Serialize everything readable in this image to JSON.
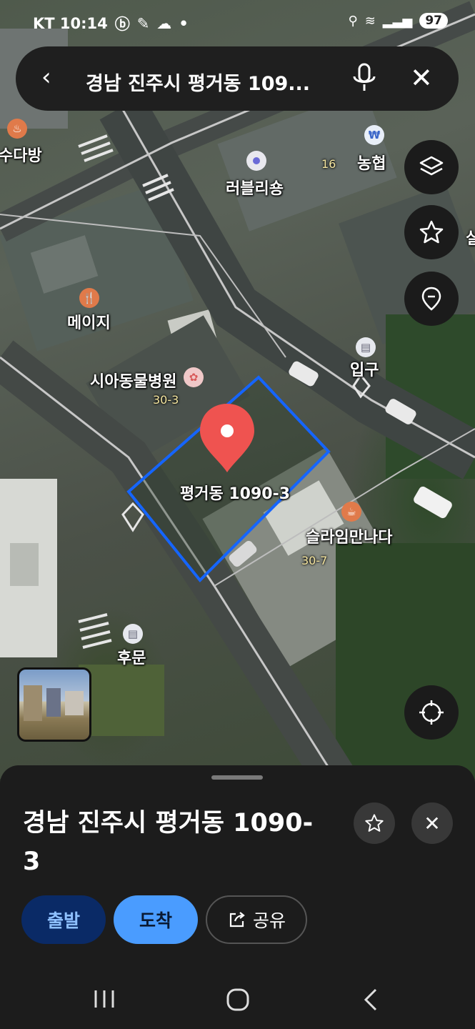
{
  "status_bar": {
    "carrier_time": "KT 10:14",
    "battery": "97"
  },
  "search": {
    "query": "경남 진주시 평거동 109..."
  },
  "map": {
    "labels": {
      "cafe_top": "수다방",
      "love_ly": "러블리숑",
      "nonghyup": "농협",
      "num_16": "16",
      "maiji": "메이지",
      "hospital": "시아동물병원",
      "num_30_3": "30-3",
      "entrance": "입구",
      "parcel": "평거동 1090-3",
      "slime": "슬라임만나다",
      "num_30_7": "30-7",
      "back_gate": "후문",
      "edge_right": "실"
    }
  },
  "sheet": {
    "title": "경남 진주시 평거동 1090-3",
    "buttons": {
      "depart": "출발",
      "arrive": "도착",
      "share": "공유"
    }
  },
  "colors": {
    "parcel_outline": "#1565ff",
    "pin": "#ef5350",
    "arrive": "#4a9cff",
    "depart": "#0a2a66"
  }
}
